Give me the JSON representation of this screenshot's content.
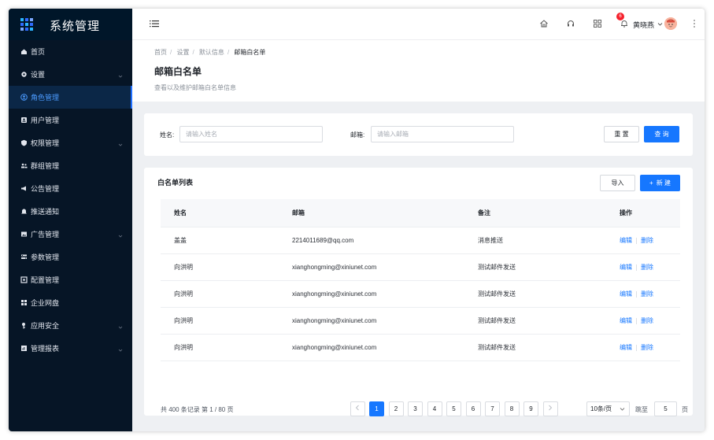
{
  "app": {
    "title": "系统管理"
  },
  "sidebar": {
    "items": [
      {
        "label": "首页",
        "icon": "home-icon",
        "arrow": false,
        "active": false
      },
      {
        "label": "设置",
        "icon": "gear-icon",
        "arrow": true,
        "active": false
      },
      {
        "label": "角色管理",
        "icon": "user-circle-icon",
        "arrow": false,
        "active": true
      },
      {
        "label": "用户管理",
        "icon": "id-card-icon",
        "arrow": false,
        "active": false
      },
      {
        "label": "权限管理",
        "icon": "shield-icon",
        "arrow": true,
        "active": false
      },
      {
        "label": "群组管理",
        "icon": "group-icon",
        "arrow": false,
        "active": false
      },
      {
        "label": "公告管理",
        "icon": "megaphone-icon",
        "arrow": false,
        "active": false
      },
      {
        "label": "推送通知",
        "icon": "bell-icon",
        "arrow": false,
        "active": false
      },
      {
        "label": "广告管理",
        "icon": "image-icon",
        "arrow": true,
        "active": false
      },
      {
        "label": "参数管理",
        "icon": "sliders-icon",
        "arrow": false,
        "active": false
      },
      {
        "label": "配置管理",
        "icon": "config-icon",
        "arrow": false,
        "active": false
      },
      {
        "label": "企业网盘",
        "icon": "grid-icon",
        "arrow": false,
        "active": false
      },
      {
        "label": "应用安全",
        "icon": "lock-key-icon",
        "arrow": true,
        "active": false
      },
      {
        "label": "管理报表",
        "icon": "report-icon",
        "arrow": true,
        "active": false
      }
    ]
  },
  "header": {
    "notification_count": "6",
    "user_name": "黄晓燕"
  },
  "page": {
    "breadcrumb": [
      "首页",
      "设置",
      "默认信息",
      "邮箱白名单"
    ],
    "title": "邮箱白名单",
    "description": "查看以及维护邮箱白名单信息"
  },
  "filter": {
    "name_label": "姓名:",
    "name_placeholder": "请输入姓名",
    "email_label": "邮箱:",
    "email_placeholder": "请输入邮箱",
    "reset_label": "重 置",
    "search_label": "查 询"
  },
  "table": {
    "title": "白名单列表",
    "import_label": "导入",
    "new_label": "新 建",
    "columns": [
      "姓名",
      "邮箱",
      "备注",
      "操作"
    ],
    "rows": [
      {
        "name": "盖盖",
        "email": "2214011689@qq.com",
        "note": "消息推送"
      },
      {
        "name": "向洪明",
        "email": "xianghongming@xiniunet.com",
        "note": "测试邮件发送"
      },
      {
        "name": "向洪明",
        "email": "xianghongming@xiniunet.com",
        "note": "测试邮件发送"
      },
      {
        "name": "向洪明",
        "email": "xianghongming@xiniunet.com",
        "note": "测试邮件发送"
      },
      {
        "name": "向洪明",
        "email": "xianghongming@xiniunet.com",
        "note": "测试邮件发送"
      }
    ],
    "edit_label": "编辑",
    "delete_label": "删除"
  },
  "pagination": {
    "total_text": "共 400 条记录 第 1 / 80 页",
    "pages": [
      "1",
      "2",
      "3",
      "4",
      "5",
      "6",
      "7",
      "8",
      "9"
    ],
    "current_page": "1",
    "page_size": "10条/页",
    "jump_label": "跳至",
    "jump_value": "5",
    "jump_unit": "页"
  },
  "colors": {
    "sidebar_bg": "#061526",
    "primary": "#1677ff",
    "badge": "#f5222d"
  }
}
